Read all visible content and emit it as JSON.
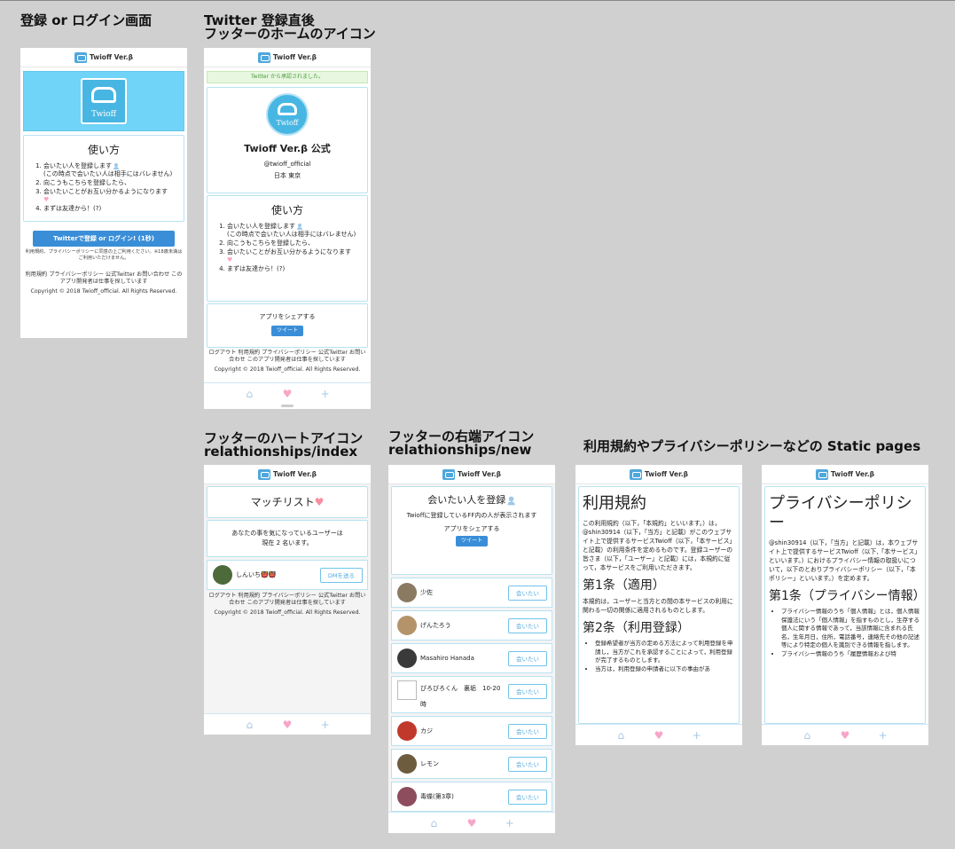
{
  "captions": {
    "c1": "登録 or ログイン画面",
    "c2_1": "Twitter 登録直後",
    "c2_2": "フッターのホームのアイコン",
    "c3_1": "フッターのハートアイコン",
    "c3_2": "relathionships/index",
    "c4_1": "フッターの右端アイコン",
    "c4_2": "relathionships/new",
    "c5": "利用規約やプライバシーポリシーなどの Static pages"
  },
  "app": {
    "title": "Twioff Ver.β",
    "logo_text": "Twioff"
  },
  "usage": {
    "heading": "使い方",
    "step1": "会いたい人を登録します",
    "step1_note": "(この時点で会いたい人は相手にはバレません)",
    "step2": "向こうもこちらを登録したら、",
    "step3": "会いたいことがお互い分かるようになります",
    "step4": "まずは友達から！(?)"
  },
  "login": {
    "button": "Twitterで登録 or ログイン! (1秒)",
    "notice": "利用規約、プライバシーポリシーに同意の上ご利用ください。※18歳未満はご利用いただけません。",
    "footer": "利用規約 プライバシーポリシー 公式Twitter お問い合わせ このアプリ開発者は仕事を探しています",
    "copyright": "Copyright © 2018 Twioff_official. All Rights Reserved."
  },
  "profile": {
    "flash": "Twitter から承認されました。",
    "name": "Twioff Ver.β 公式",
    "handle": "@twioff_official",
    "location": "日本 東京",
    "share_label": "アプリをシェアする",
    "tweet": "ツイート",
    "footer": "ログアウト 利用規約 プライバシーポリシー 公式Twitter お問い合わせ このアプリ開発者は仕事を探しています"
  },
  "matches": {
    "title": "マッチリスト",
    "message1": "あなたの事を気になっているユーザーは",
    "message2": "現在 2 名います。",
    "user": "しんいち👹👹",
    "dm_button": "DMを送る"
  },
  "newrel": {
    "title": "会いたい人を登録",
    "desc": "Twioffに登録しているFF内の人が表示されます",
    "share_label": "アプリをシェアする",
    "button": "会いたい",
    "users": [
      "少佐",
      "げんたろう",
      "Masahiro Hanada",
      "ぴろぴろくん　裏垢　10-20時",
      "カジ",
      "レモン",
      "毒蝶(第3章)"
    ]
  },
  "terms": {
    "title": "利用規約",
    "intro": "この利用規約（以下，「本規約」といいます。）は，@shin30914（以下，「当方」と記載）がこのウェブサイト上で提供するサービスTwioff（以下，「本サービス」と記載）の利用条件を定めるものです。登録ユーザーの皆さま（以下，「ユーザー」と記載）には，本規約に従って，本サービスをご利用いただきます。",
    "art1": "第1条（適用）",
    "art1_body": "本規約は，ユーザーと当方との間の本サービスの利用に関わる一切の関係に適用されるものとします。",
    "art2": "第2条（利用登録）",
    "art2_li1": "登録希望者が当方の定める方法によって利用登録を申請し，当方がこれを承認することによって，利用登録が完了するものとします。",
    "art2_li2": "当方は，利用登録の申請者に以下の事由があ"
  },
  "privacy": {
    "title": "プライバシーポリシー",
    "intro": "@shin30914（以下，「当方」と記載）は，本ウェブサイト上で提供するサービスTwioff（以下,「本サービス」といいます。）におけるプライバシー情報の取扱いについて，以下のとおりプライバシーポリシー（以下，「本ポリシー」といいます。）を定めます。",
    "art1": "第1条（プライバシー情報）",
    "li1": "プライバシー情報のうち「個人情報」とは，個人情報保護法にいう「個人情報」を指すものとし，生存する個人に関する情報であって，当該情報に含まれる氏名，生年月日，住所，電話番号，連絡先その他の記述等により特定の個人を識別できる情報を指します。",
    "li2": "プライバシー情報のうち「履歴情報および特"
  },
  "tabs": {
    "home": "⌂",
    "heart": "♥",
    "add": "+"
  },
  "colors": {
    "accent": "#3a8ed8",
    "banner": "#6fd4f7",
    "border": "#b8e2f2",
    "heart": "#f7a6c8"
  }
}
